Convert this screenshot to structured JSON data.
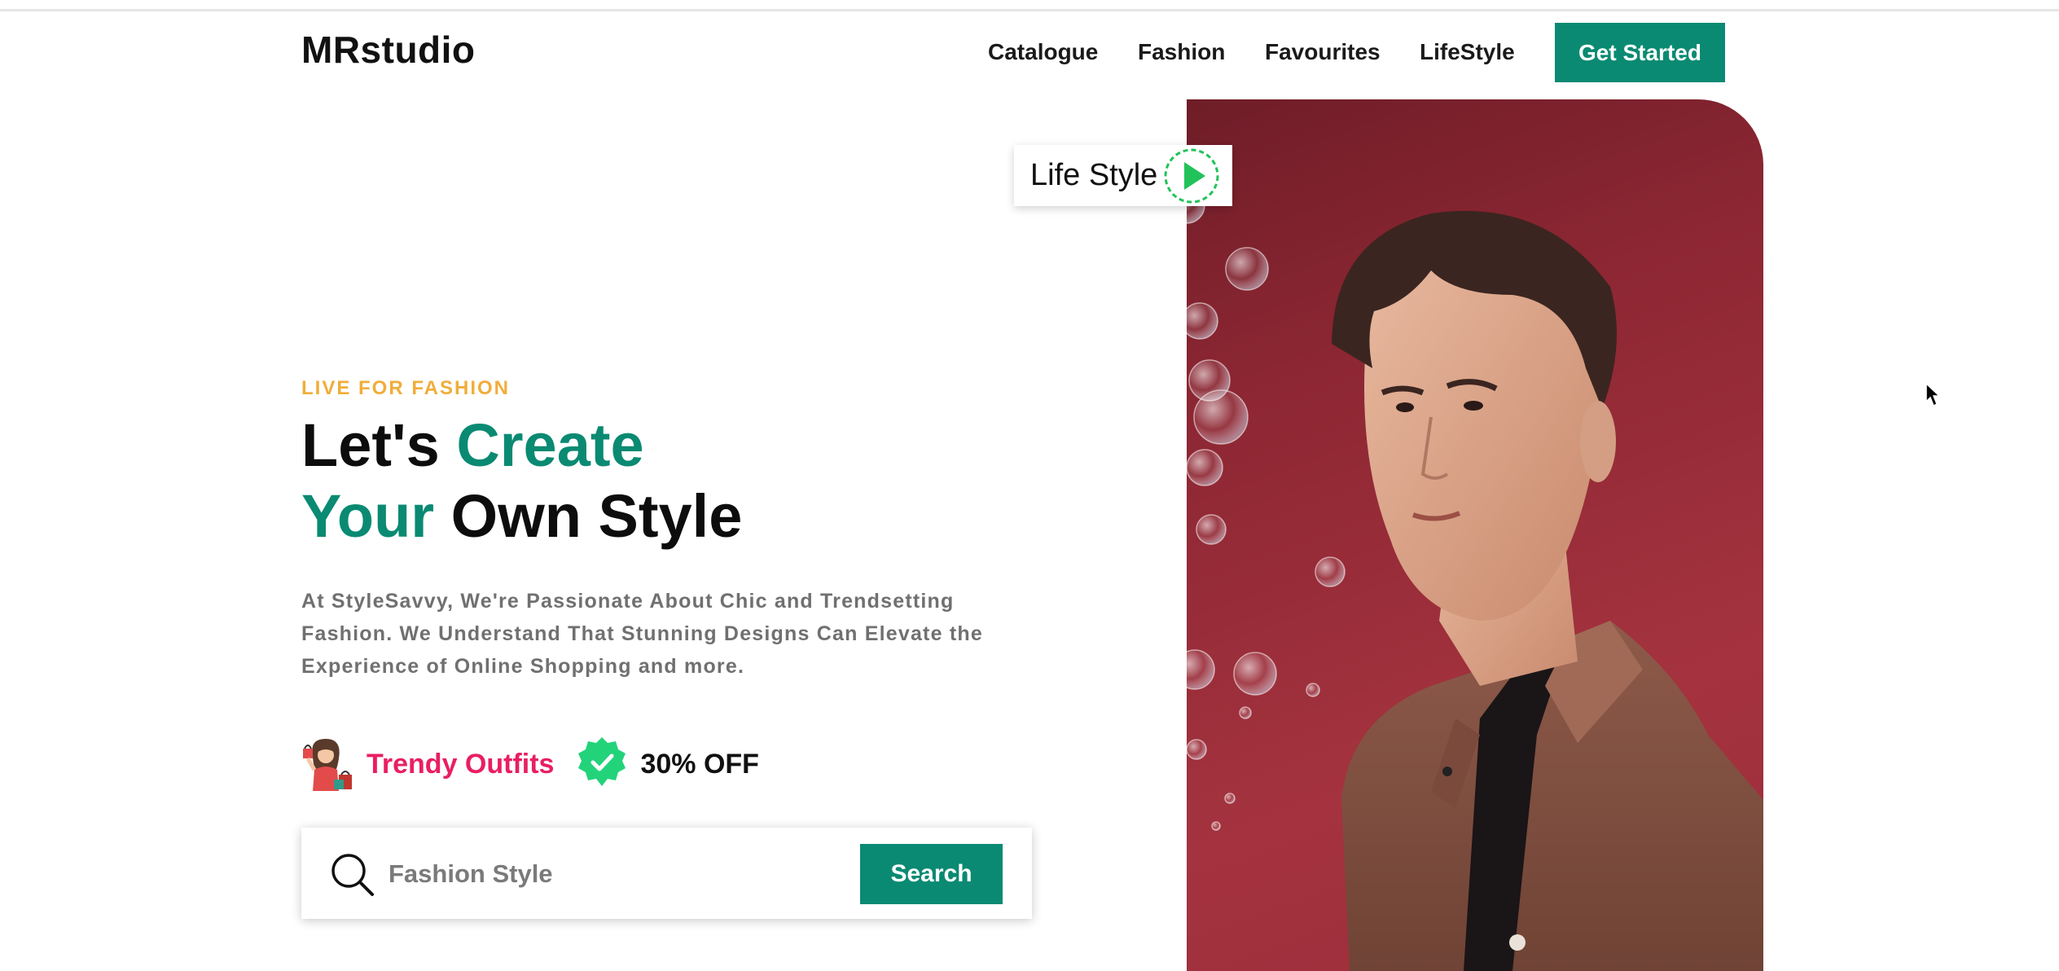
{
  "header": {
    "logo": "MRstudio",
    "nav": [
      "Catalogue",
      "Fashion",
      "Favourites",
      "LifeStyle"
    ],
    "cta_label": "Get Started"
  },
  "hero": {
    "eyebrow": "LIVE FOR FASHION",
    "headline": {
      "line1_plain": "Let's ",
      "line1_accent": "Create",
      "line2_accent": "Your",
      "line2_plain": " Own Style"
    },
    "description": "At StyleSavvy, We're Passionate About Chic and Trendsetting Fashion. We Understand That Stunning Designs Can Elevate the Experience of Online Shopping and more.",
    "badges": {
      "trendy_label": "Trendy Outfits",
      "discount_label": "30% OFF"
    }
  },
  "search": {
    "placeholder": "Fashion Style",
    "button_label": "Search"
  },
  "media": {
    "lifestyle_label": "Life Style"
  },
  "colors": {
    "accent": "#0a8a72",
    "eyebrow": "#f0ad3a",
    "trendy": "#e91e63",
    "photo_bg": "#9c2d3a",
    "badge_green": "#22d37a"
  }
}
